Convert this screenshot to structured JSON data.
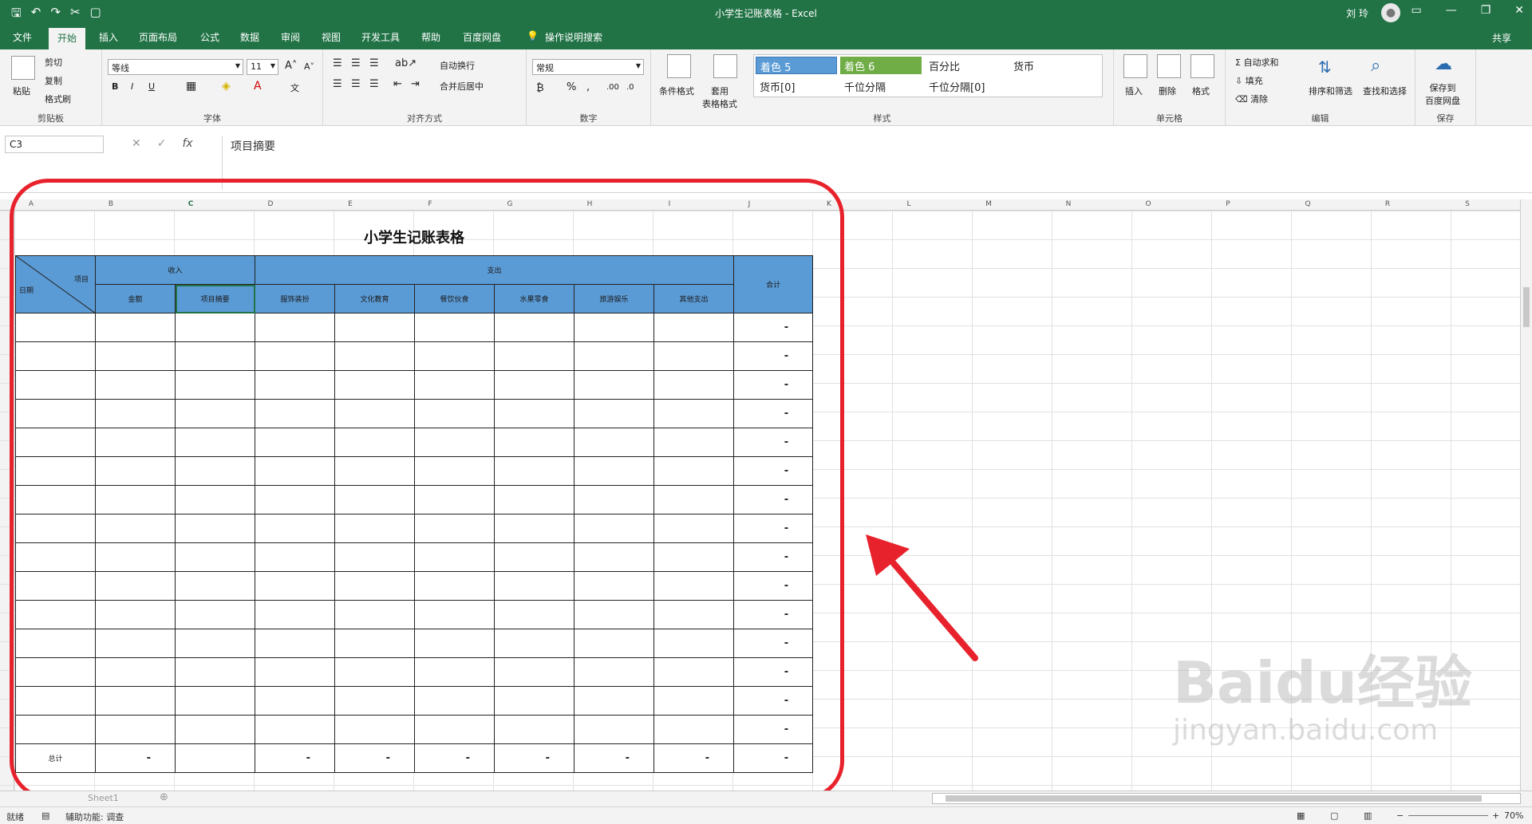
{
  "window": {
    "title": "小学生记账表格 - Excel",
    "user": "刘 玲"
  },
  "tabs": [
    "文件",
    "开始",
    "插入",
    "页面布局",
    "公式",
    "数据",
    "审阅",
    "视图",
    "开发工具",
    "帮助",
    "百度网盘",
    "操作说明搜索"
  ],
  "share_label": "共享",
  "ribbon": {
    "clipboard": {
      "paste": "粘贴",
      "cut": "剪切",
      "copy": "复制",
      "format_painter": "格式刷",
      "label": "剪贴板"
    },
    "font": {
      "name": "等线",
      "size": "11",
      "label": "字体"
    },
    "alignment": {
      "wrap": "自动换行",
      "merge": "合并后居中",
      "label": "对齐方式"
    },
    "number": {
      "format": "常规",
      "label": "数字"
    },
    "styles": {
      "cond": "条件格式",
      "table": "套用\n表格格式",
      "label": "样式",
      "cells": [
        "着色 5",
        "着色 6",
        "百分比",
        "货币",
        "货币[0]",
        "千位分隔",
        "千位分隔[0]"
      ]
    },
    "cells": {
      "insert": "插入",
      "delete": "删除",
      "format": "格式",
      "label": "单元格"
    },
    "editing": {
      "autosum": "自动求和",
      "fill": "填充",
      "clear": "清除",
      "sort": "排序和筛选",
      "find": "查找和选择",
      "label": "编辑"
    },
    "save": {
      "btn": "保存到\n百度网盘",
      "label": "保存"
    }
  },
  "formula_bar": {
    "cell_ref": "C3",
    "content": "项目摘要"
  },
  "columns": [
    "A",
    "B",
    "C",
    "D",
    "E",
    "F",
    "G",
    "H",
    "I",
    "J",
    "K",
    "L",
    "M",
    "N",
    "O",
    "P",
    "Q",
    "R",
    "S"
  ],
  "ledger": {
    "title": "小学生记账表格",
    "date_label": "日期",
    "item_label": "项目",
    "income": "收入",
    "expense": "支出",
    "total_col": "合计",
    "income_cols": [
      "金额",
      "项目摘要"
    ],
    "expense_cols": [
      "服饰装扮",
      "文化教育",
      "餐饮伙食",
      "水果零食",
      "旅游娱乐",
      "其他支出"
    ],
    "dash": "-",
    "total_row": "总计"
  },
  "status": {
    "ready": "就绪",
    "accessibility": "辅助功能: 调查",
    "zoom": "70%"
  },
  "sheet_tab": "Sheet1",
  "watermark": {
    "brand": "Baidu经验",
    "url": "jingyan.baidu.com"
  },
  "colors": {
    "excel_green": "#217346",
    "header_blue": "#5b9bd5",
    "annotation_red": "#e8222c"
  }
}
